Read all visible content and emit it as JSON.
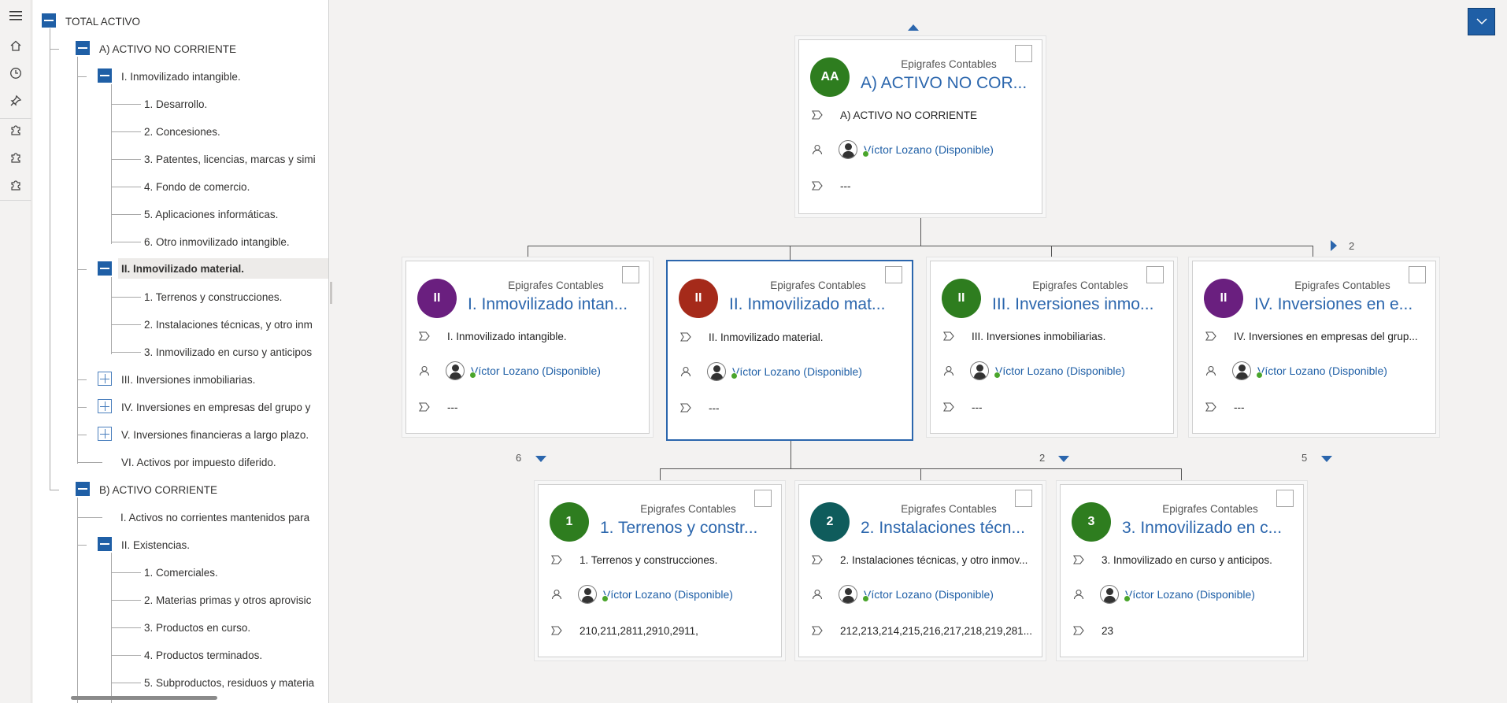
{
  "tree": {
    "nodes": [
      {
        "label": "TOTAL ACTIVO"
      },
      {
        "label": "A) ACTIVO NO CORRIENTE"
      },
      {
        "label": "I. Inmovilizado intangible."
      },
      {
        "label": "1. Desarrollo."
      },
      {
        "label": "2. Concesiones."
      },
      {
        "label": "3. Patentes, licencias, marcas y simi"
      },
      {
        "label": "4. Fondo de comercio."
      },
      {
        "label": "5. Aplicaciones informáticas."
      },
      {
        "label": "6. Otro inmovilizado intangible."
      },
      {
        "label": "II. Inmovilizado material."
      },
      {
        "label": "1. Terrenos y construcciones."
      },
      {
        "label": "2. Instalaciones técnicas, y otro inm"
      },
      {
        "label": "3. Inmovilizado en curso y anticipos"
      },
      {
        "label": "III. Inversiones inmobiliarias."
      },
      {
        "label": "IV. Inversiones en empresas del grupo y"
      },
      {
        "label": "V. Inversiones financieras a largo plazo."
      },
      {
        "label": "VI. Activos por impuesto diferido."
      },
      {
        "label": "B) ACTIVO CORRIENTE"
      },
      {
        "label": "I. Activos no corrientes mantenidos para"
      },
      {
        "label": "II. Existencias."
      },
      {
        "label": "1. Comerciales."
      },
      {
        "label": "2. Materias primas y otros aprovisic"
      },
      {
        "label": "3. Productos en curso."
      },
      {
        "label": "4. Productos terminados."
      },
      {
        "label": "5. Subproductos, residuos y materia"
      }
    ]
  },
  "cards": [
    {
      "initials": "AA",
      "color": "#2e7d1f",
      "category": "Epigrafes Contables",
      "title": "A) ACTIVO NO COR...",
      "name": "A) ACTIVO NO CORRIENTE",
      "person": "Víctor Lozano (Disponible)",
      "accounts": "---"
    },
    {
      "initials": "II",
      "color": "#6a1f7f",
      "category": "Epigrafes Contables",
      "title": "I. Inmovilizado intan...",
      "name": "I. Inmovilizado intangible.",
      "person": "Víctor Lozano (Disponible)",
      "accounts": "---"
    },
    {
      "initials": "II",
      "color": "#a52a1a",
      "category": "Epigrafes Contables",
      "title": "II. Inmovilizado mat...",
      "name": "II. Inmovilizado material.",
      "person": "Víctor Lozano (Disponible)",
      "accounts": "---"
    },
    {
      "initials": "II",
      "color": "#2e7d1f",
      "category": "Epigrafes Contables",
      "title": "III. Inversiones inmo...",
      "name": "III. Inversiones inmobiliarias.",
      "person": "Víctor Lozano (Disponible)",
      "accounts": "---"
    },
    {
      "initials": "II",
      "color": "#6a1f7f",
      "category": "Epigrafes Contables",
      "title": "IV. Inversiones en e...",
      "name": "IV. Inversiones en empresas del grup...",
      "person": "Víctor Lozano (Disponible)",
      "accounts": "---"
    },
    {
      "initials": "1",
      "color": "#2e7d1f",
      "category": "Epigrafes Contables",
      "title": "1. Terrenos y constr...",
      "name": "1. Terrenos y construcciones.",
      "person": "Víctor Lozano (Disponible)",
      "accounts": "210,211,2811,2910,2911,"
    },
    {
      "initials": "2",
      "color": "#0f5c5c",
      "category": "Epigrafes Contables",
      "title": "2. Instalaciones técn...",
      "name": "2. Instalaciones técnicas, y otro inmov...",
      "person": "Víctor Lozano (Disponible)",
      "accounts": "212,213,214,215,216,217,218,219,281..."
    },
    {
      "initials": "3",
      "color": "#2e7d1f",
      "category": "Epigrafes Contables",
      "title": "3. Inmovilizado en c...",
      "name": "3. Inmovilizado en curso y anticipos.",
      "person": "Víctor Lozano (Disponible)",
      "accounts": "23"
    }
  ],
  "counts": {
    "c1": "6",
    "c3": "2",
    "c4": "5",
    "more_siblings": "2"
  }
}
